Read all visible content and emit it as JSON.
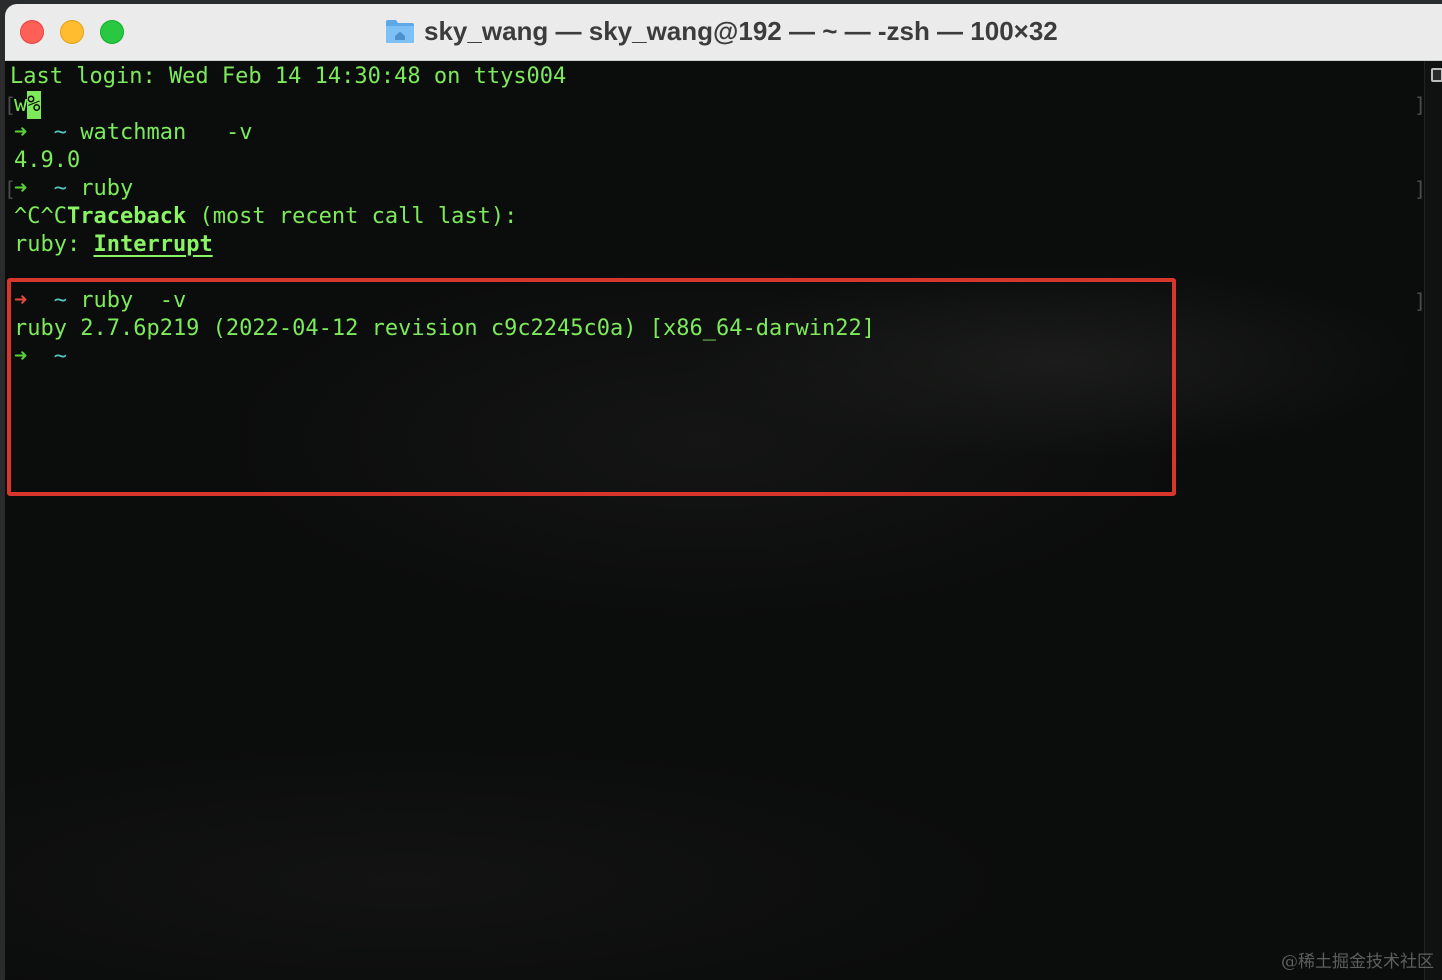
{
  "window": {
    "title": "sky_wang — sky_wang@192 — ~ — -zsh — 100×32",
    "title_icon": "folder-home-icon"
  },
  "terminal": {
    "colors": {
      "text": "#7dea5c",
      "prompt_ok_arrow": "#58d43a",
      "prompt_err_arrow": "#e24a3b",
      "tilde": "#55c9c0",
      "highlight_box": "#d8352c"
    },
    "last_login": "Last login: Wed Feb 14 14:30:48 on ttys004",
    "line2_text": "w",
    "line2_cursor": "%",
    "cmd1": {
      "arrow": "➜",
      "cwd": "~",
      "command": "watchman   -v"
    },
    "cmd1_output": "4.9.0",
    "cmd2": {
      "arrow": "➜",
      "cwd": "~",
      "command": "ruby"
    },
    "cmd2_output_1_prefix": "^C^C",
    "cmd2_output_1_bold": "Traceback",
    "cmd2_output_1_rest": " (most recent call last):",
    "cmd2_output_2_prefix": "ruby: ",
    "cmd2_output_2_underlined": "Interrupt",
    "cmd3": {
      "arrow": "➜",
      "cwd": "~",
      "command": "ruby  -v"
    },
    "cmd3_output": "ruby 2.7.6p219 (2022-04-12 revision c9c2245c0a) [x86_64-darwin22]",
    "cmd4": {
      "arrow": "➜",
      "cwd": "~"
    },
    "bracket_left": "[",
    "bracket_right": "]"
  },
  "watermark": "@稀土掘金技术社区"
}
